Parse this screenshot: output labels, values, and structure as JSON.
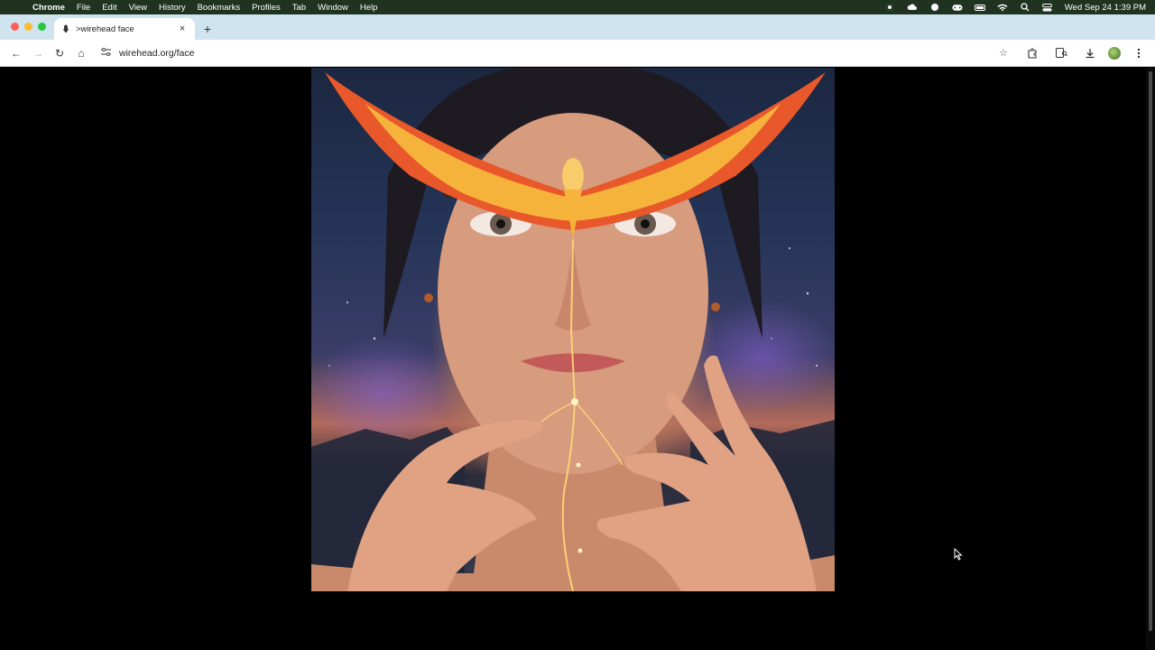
{
  "menubar": {
    "apple_icon": "apple-icon",
    "items": [
      "Chrome",
      "File",
      "Edit",
      "View",
      "History",
      "Bookmarks",
      "Profiles",
      "Tab",
      "Window",
      "Help"
    ],
    "clock": "Wed Sep 24  1:39 PM"
  },
  "tab": {
    "title": ">wirehead face",
    "close_glyph": "×",
    "new_tab_glyph": "+"
  },
  "toolbar": {
    "back_glyph": "←",
    "forward_glyph": "→",
    "reload_glyph": "↻",
    "home_glyph": "⌂",
    "url": "wirehead.org/face",
    "star_glyph": "☆"
  },
  "colors": {
    "menubar_bg": "#1f3320",
    "tabstrip_bg": "#cfe4ee",
    "page_bg": "#000000",
    "wing_primary": "#e8582a",
    "wing_secondary": "#f6b33c"
  }
}
